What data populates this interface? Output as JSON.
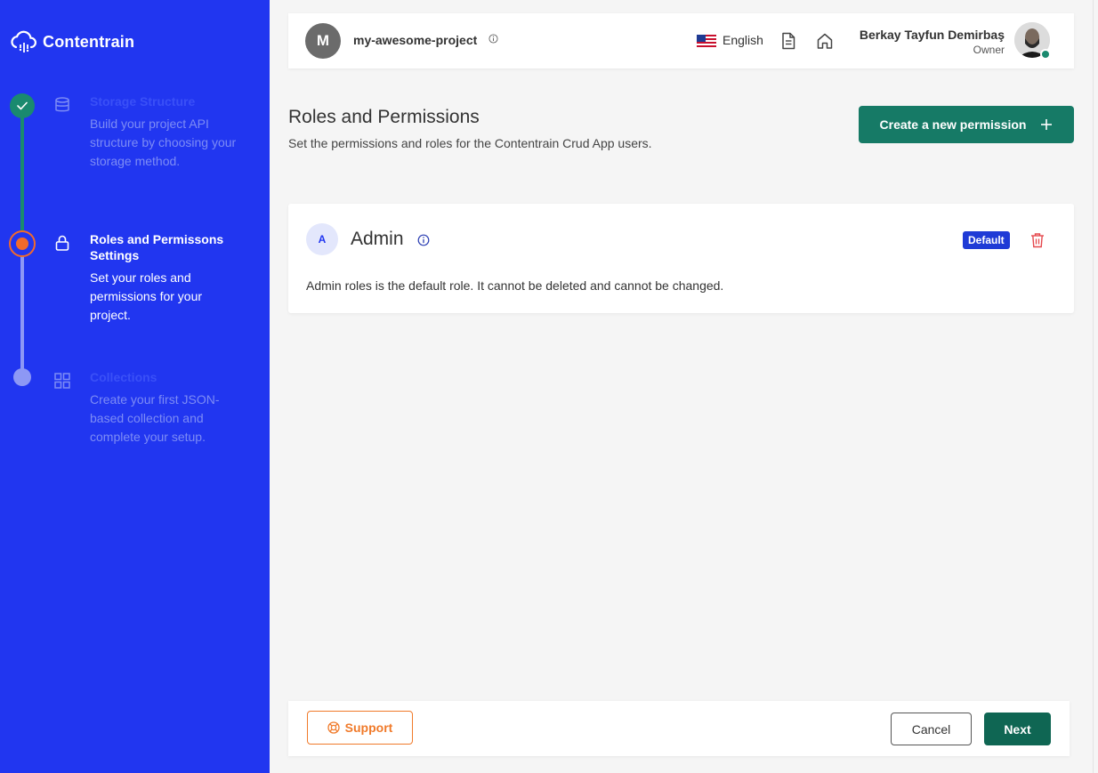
{
  "app": {
    "brand": "Contentrain"
  },
  "colors": {
    "sidebar_bg": "#2136f0",
    "accent_green": "#167a66",
    "accent_orange": "#f07a2a",
    "badge_blue": "#1f3bd6",
    "danger": "#e5484d"
  },
  "steps": [
    {
      "title": "Storage Structure",
      "desc": "Build your project API structure by choosing your storage method.",
      "status": "done",
      "icon": "database-icon"
    },
    {
      "title": "Roles and Permissons Settings",
      "desc": "Set your roles and permissions for your project.",
      "status": "current",
      "icon": "lock-icon"
    },
    {
      "title": "Collections",
      "desc": "Create your first JSON-based collection and complete your setup.",
      "status": "pending",
      "icon": "grid-icon"
    }
  ],
  "header": {
    "project_initial": "M",
    "project_name": "my-awesome-project",
    "language": "English",
    "user_name": "Berkay Tayfun Demirbaş",
    "user_role": "Owner"
  },
  "page": {
    "title": "Roles and Permissions",
    "subtitle": "Set the permissions and roles for the Contentrain Crud App users.",
    "create_button": "Create a new permission"
  },
  "roles": [
    {
      "initial": "A",
      "name": "Admin",
      "badge": "Default",
      "desc": "Admin roles is the default role. It cannot be deleted and cannot be changed."
    }
  ],
  "footer": {
    "support": "Support",
    "cancel": "Cancel",
    "next": "Next"
  }
}
